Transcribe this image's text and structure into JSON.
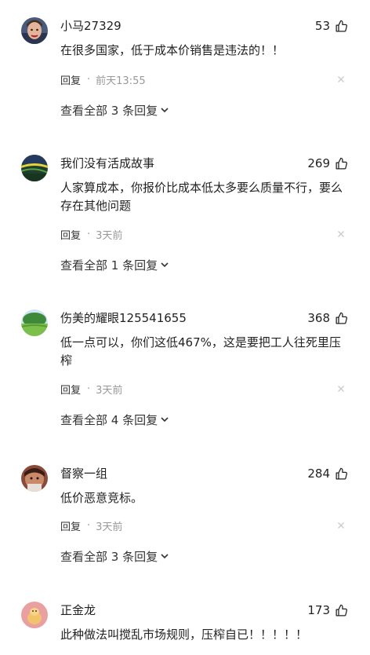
{
  "comments": [
    {
      "username": "小马27329",
      "likes": "53",
      "text": "在很多国家，低于成本价销售是违法的！！",
      "reply_label": "回复",
      "time": "前天13:55",
      "view_replies": "查看全部 3 条回复"
    },
    {
      "username": "我们没有活成故事",
      "likes": "269",
      "text": "人家算成本，你报价比成本低太多要么质量不行，要么存在其他问题",
      "reply_label": "回复",
      "time": "3天前",
      "view_replies": "查看全部 1 条回复"
    },
    {
      "username": "伤美的耀眼125541655",
      "likes": "368",
      "text": "低一点可以，你们这低467%，这是要把工人往死里压榨",
      "reply_label": "回复",
      "time": "3天前",
      "view_replies": "查看全部 4 条回复"
    },
    {
      "username": "督察一组",
      "likes": "284",
      "text": "低价恶意竞标。",
      "reply_label": "回复",
      "time": "3天前",
      "view_replies": "查看全部 3 条回复"
    },
    {
      "username": "正金龙",
      "likes": "173",
      "text": "此种做法叫搅乱市场规则，压榨自已！！！！！"
    }
  ],
  "icons": {
    "like": "thumbs-up-icon",
    "close": "close-icon",
    "expand": "chevron-down-icon"
  },
  "colors": {
    "text": "#222222",
    "muted": "#999999",
    "close": "#cccccc"
  }
}
